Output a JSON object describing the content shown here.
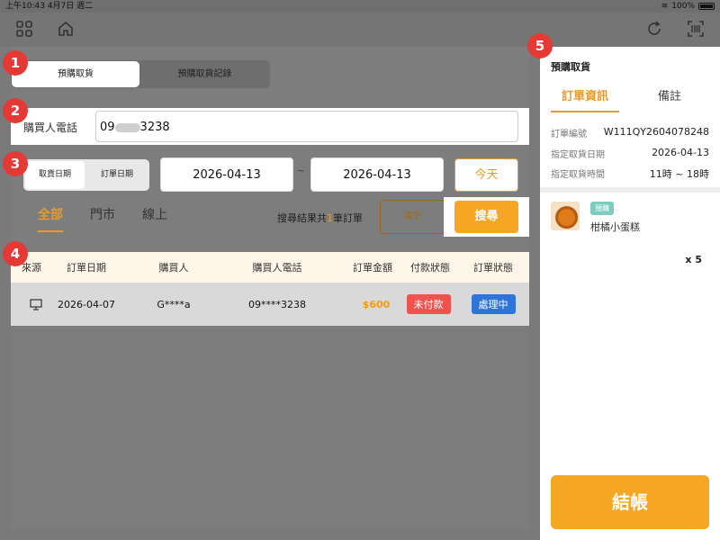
{
  "status_bar": {
    "time": "上午10:43",
    "date": "4月7日 週二",
    "battery": "100%"
  },
  "toolbar": {
    "left_icons": [
      "grid-icon",
      "home-icon"
    ],
    "right_icons": [
      "refresh-icon",
      "scan-icon"
    ]
  },
  "badges": [
    "1",
    "2",
    "3",
    "4",
    "5"
  ],
  "pickup_tabs": {
    "active": "預購取貨",
    "inactive": "預購取貨記錄"
  },
  "phone": {
    "label": "購買人電話",
    "prefix": "09",
    "suffix": "3238"
  },
  "date_filter": {
    "type_active": "取貨日期",
    "type_inactive": "訂單日期",
    "start": "2026-04-13",
    "separator": "~",
    "end": "2026-04-13",
    "today": "今天"
  },
  "source_tabs": [
    "全部",
    "門市",
    "線上"
  ],
  "result": {
    "prefix": "搜尋結果共",
    "count": "1",
    "suffix": "筆訂單"
  },
  "buttons": {
    "clear": "清空",
    "search": "搜尋"
  },
  "table": {
    "headers": [
      "來源",
      "訂單日期",
      "購買人",
      "購買人電話",
      "訂單金額",
      "付款狀態",
      "訂單狀態"
    ],
    "rows": [
      {
        "source_icon": "monitor-icon",
        "date": "2026-04-07",
        "buyer": "G****a",
        "phone": "09****3238",
        "amount": "$600",
        "payment": "未付款",
        "status": "處理中"
      }
    ]
  },
  "panel": {
    "title": "預購取貨",
    "tabs": [
      "訂單資訊",
      "備註"
    ],
    "info": [
      {
        "key": "訂單編號",
        "value": "W111QY2604078248"
      },
      {
        "key": "指定取貨日期",
        "value": "2026-04-13"
      },
      {
        "key": "指定取貨時間",
        "value": "11時 ~ 18時"
      }
    ],
    "item": {
      "tag": "預購",
      "name": "柑橘小蛋糕",
      "qty": "x 5"
    },
    "checkout": "結帳"
  },
  "colors": {
    "accent": "#f5a623",
    "badge": "#e53935",
    "unpaid": "#ef5350",
    "processing": "#2f74d8"
  }
}
